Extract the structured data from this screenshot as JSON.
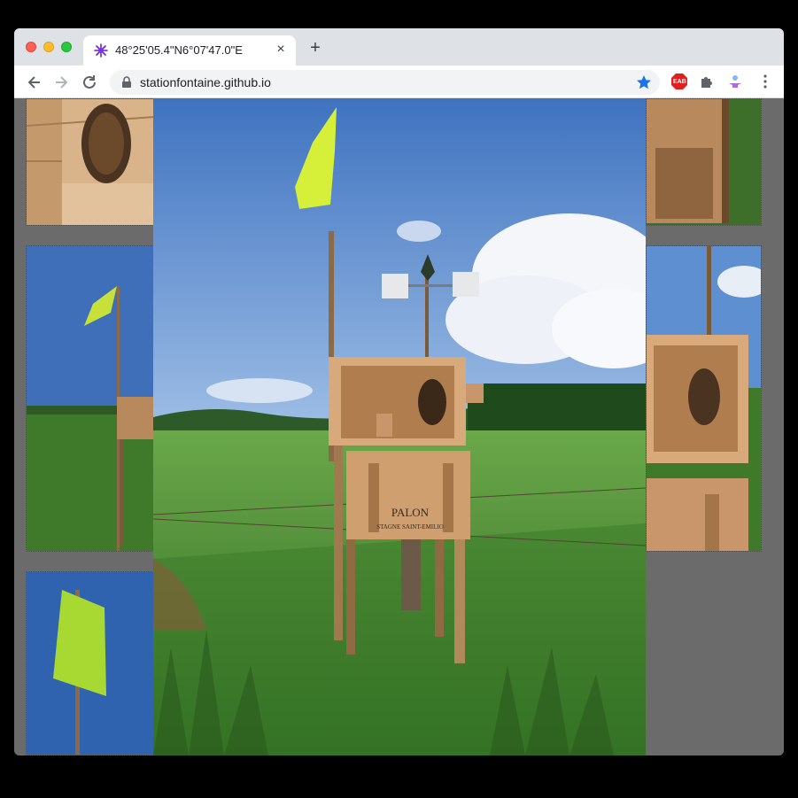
{
  "browser": {
    "tab_title": "48°25'05.4\"N6°07'47.0\"E",
    "tab_favicon": "sparkle-favicon-icon",
    "url": "stationfontaine.github.io",
    "close_tab_glyph": "×",
    "new_tab_glyph": "+",
    "icons": {
      "back": "back-arrow-icon",
      "forward": "forward-arrow-icon",
      "reload": "reload-icon",
      "lock": "lock-icon",
      "bookmark": "star-icon",
      "ext1": "eab-extension-icon",
      "ext2": "puzzle-extension-icon",
      "ext3": "profile-extension-icon",
      "menu": "kebab-menu-icon"
    },
    "ext1_label": "EAB"
  },
  "gallery": {
    "main_photo_sign_text": "PALON",
    "main_photo_sign_subtext": "STAGNE SAINT-EMILIO",
    "colors": {
      "sky": "#4a7fc4",
      "grass": "#3f7a2a",
      "flag": "#d6f03a",
      "wood": "#c89a6a",
      "backdrop": "#6b6b6b"
    }
  }
}
